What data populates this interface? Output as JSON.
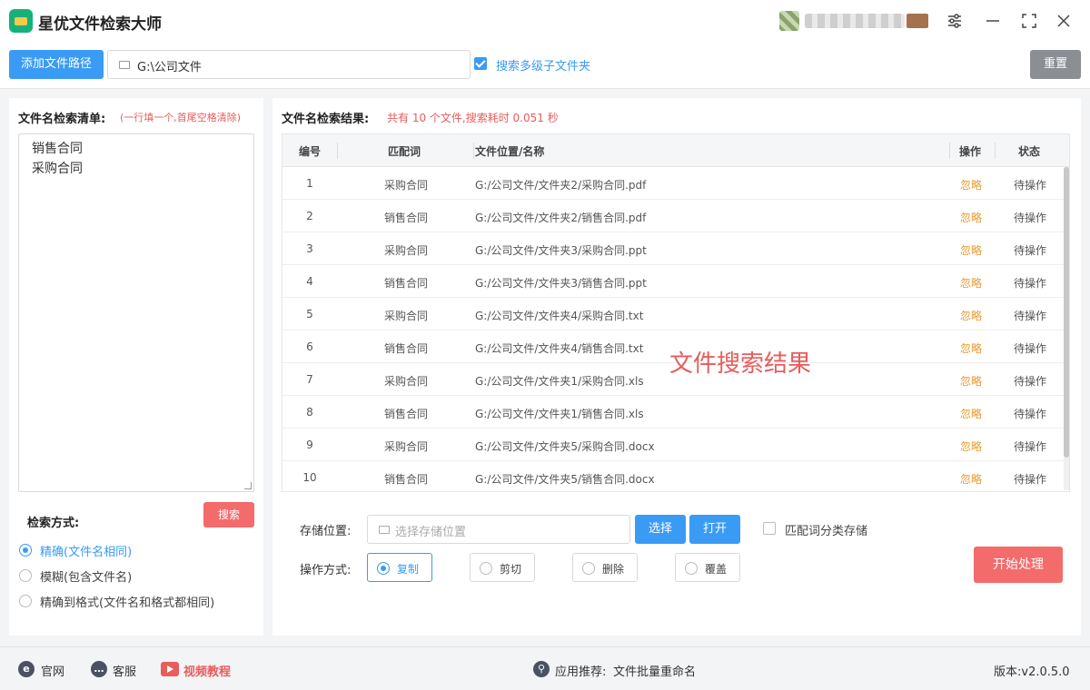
{
  "app": {
    "title": "星优文件检索大师"
  },
  "toolbar": {
    "add_path_label": "添加文件路径",
    "path_value": "G:\\公司文件",
    "subfolder_label": "搜索多级子文件夹",
    "subfolder_checked": true,
    "reset_label": "重置"
  },
  "left": {
    "title": "文件名检索清单:",
    "hint": "(一行填一个,首尾空格清除)",
    "names": [
      "销售合同",
      "采购合同"
    ],
    "method_label": "检索方式:",
    "search_label": "搜索",
    "methods": [
      {
        "label": "精确(文件名相同)",
        "selected": true
      },
      {
        "label": "模糊(包含文件名)",
        "selected": false
      },
      {
        "label": "精确到格式(文件名和格式都相同)",
        "selected": false
      }
    ]
  },
  "right": {
    "title": "文件名检索结果:",
    "summary": "共有 10 个文件,搜索耗时 0.051 秒",
    "columns": [
      "编号",
      "匹配词",
      "文件位置/名称",
      "操作",
      "状态"
    ],
    "rows": [
      {
        "no": "1",
        "word": "采购合同",
        "path": "G:/公司文件/文件夹2/采购合同.pdf",
        "op": "忽略",
        "status": "待操作"
      },
      {
        "no": "2",
        "word": "销售合同",
        "path": "G:/公司文件/文件夹2/销售合同.pdf",
        "op": "忽略",
        "status": "待操作"
      },
      {
        "no": "3",
        "word": "采购合同",
        "path": "G:/公司文件/文件夹3/采购合同.ppt",
        "op": "忽略",
        "status": "待操作"
      },
      {
        "no": "4",
        "word": "销售合同",
        "path": "G:/公司文件/文件夹3/销售合同.ppt",
        "op": "忽略",
        "status": "待操作"
      },
      {
        "no": "5",
        "word": "采购合同",
        "path": "G:/公司文件/文件夹4/采购合同.txt",
        "op": "忽略",
        "status": "待操作"
      },
      {
        "no": "6",
        "word": "销售合同",
        "path": "G:/公司文件/文件夹4/销售合同.txt",
        "op": "忽略",
        "status": "待操作"
      },
      {
        "no": "7",
        "word": "采购合同",
        "path": "G:/公司文件/文件夹1/采购合同.xls",
        "op": "忽略",
        "status": "待操作"
      },
      {
        "no": "8",
        "word": "销售合同",
        "path": "G:/公司文件/文件夹1/销售合同.xls",
        "op": "忽略",
        "status": "待操作"
      },
      {
        "no": "9",
        "word": "采购合同",
        "path": "G:/公司文件/文件夹5/采购合同.docx",
        "op": "忽略",
        "status": "待操作"
      },
      {
        "no": "10",
        "word": "销售合同",
        "path": "G:/公司文件/文件夹5/销售合同.docx",
        "op": "忽略",
        "status": "待操作"
      }
    ],
    "watermark": "文件搜索结果",
    "store_label": "存储位置:",
    "store_placeholder": "选择存储位置",
    "select_label": "选择",
    "open_label": "打开",
    "category_label": "匹配词分类存储",
    "category_checked": false,
    "op_label": "操作方式:",
    "ops": [
      {
        "label": "复制",
        "selected": true
      },
      {
        "label": "剪切",
        "selected": false
      },
      {
        "label": "删除",
        "selected": false
      },
      {
        "label": "覆盖",
        "selected": false
      }
    ],
    "start_label": "开始处理"
  },
  "footer": {
    "website": "官网",
    "service": "客服",
    "video": "视频教程",
    "recommend_label": "应用推荐:",
    "recommend_app": "文件批量重命名",
    "version": "版本:v2.0.5.0"
  }
}
